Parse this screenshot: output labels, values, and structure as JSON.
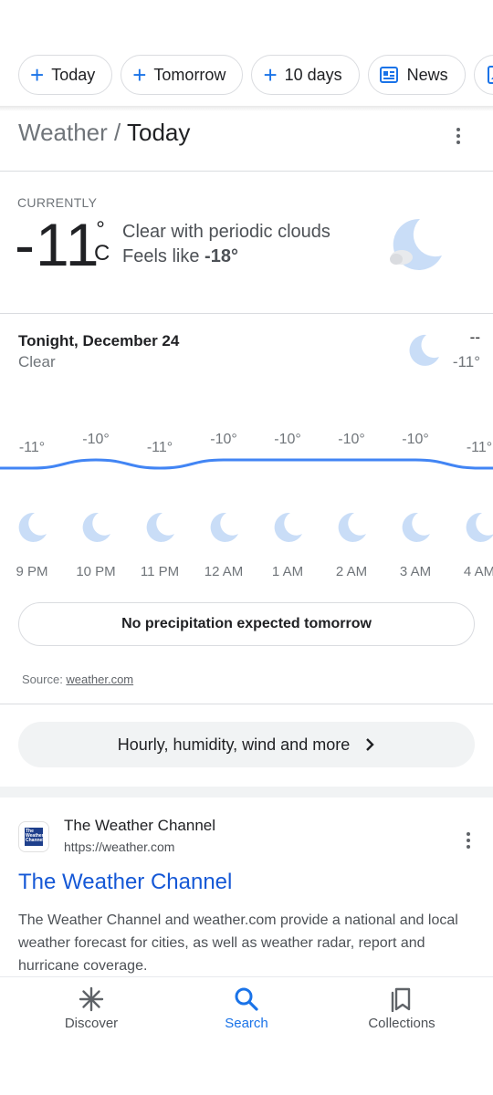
{
  "chips": [
    {
      "label": "Today",
      "icon": "plus-icon"
    },
    {
      "label": "Tomorrow",
      "icon": "plus-icon"
    },
    {
      "label": "10 days",
      "icon": "plus-icon"
    },
    {
      "label": "News",
      "icon": "newspaper-icon"
    },
    {
      "label": "",
      "icon": "image-icon"
    }
  ],
  "header": {
    "crumb_parent": "Weather /",
    "crumb_current": "Today"
  },
  "current": {
    "heading": "CURRENTLY",
    "temp": "-11",
    "degree": "°",
    "unit": "C",
    "condition": "Clear with periodic clouds",
    "feels_prefix": "Feels like ",
    "feels_value": "-18°",
    "icon": "moon-cloud-icon"
  },
  "tonight": {
    "title": "Tonight, December 24",
    "condition": "Clear",
    "high": "--",
    "low": "-11°",
    "icon": "moon-icon"
  },
  "hourly": {
    "times": [
      "9 PM",
      "10 PM",
      "11 PM",
      "12 AM",
      "1 AM",
      "2 AM",
      "3 AM",
      "4 AM"
    ],
    "temp_labels": [
      "-11°",
      "-10°",
      "-11°",
      "-10°",
      "-10°",
      "-10°",
      "-10°",
      "-11°"
    ],
    "temps": [
      -11,
      -10,
      -11,
      -10,
      -10,
      -10,
      -10,
      -11
    ],
    "icon": "moon-icon",
    "line_color": "#4285f4"
  },
  "precip": "No precipitation expected tomorrow",
  "source": {
    "prefix": "Source: ",
    "link": "weather.com"
  },
  "more_button": "Hourly, humidity, wind and more",
  "result": {
    "favicon_text": "The Weather Channel",
    "site_name": "The Weather Channel",
    "url": "https://weather.com",
    "title": "The Weather Channel",
    "snippet": "The Weather Channel and weather.com provide a national and local weather forecast for cities, as well as weather radar, report and hurricane coverage."
  },
  "bottom_nav": [
    {
      "label": "Discover",
      "icon": "asterisk-icon",
      "active": false
    },
    {
      "label": "Search",
      "icon": "search-icon",
      "active": true
    },
    {
      "label": "Collections",
      "icon": "bookmark-stack-icon",
      "active": false
    }
  ],
  "colors": {
    "accent": "#1a73e8",
    "moon": "#c9ddf7",
    "link": "#1558d6"
  }
}
